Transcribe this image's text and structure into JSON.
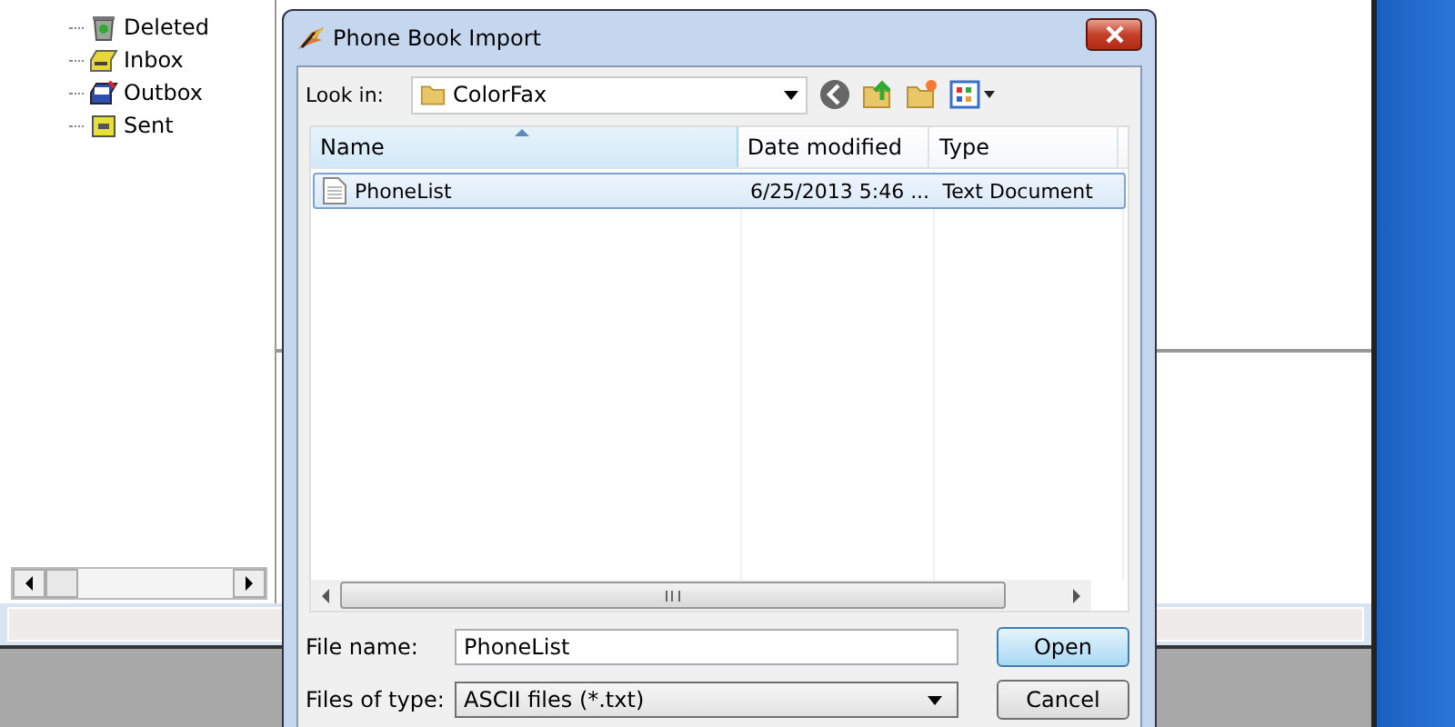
{
  "tree": {
    "items": [
      {
        "label": "Deleted",
        "kind": "trash"
      },
      {
        "label": "Inbox",
        "kind": "inbox"
      },
      {
        "label": "Outbox",
        "kind": "outbox"
      },
      {
        "label": "Sent",
        "kind": "sent"
      }
    ]
  },
  "dialog": {
    "title": "Phone Book Import",
    "look_in_label": "Look in:",
    "look_in_value": "ColorFax",
    "columns": [
      {
        "label": "Name",
        "sorted": true
      },
      {
        "label": "Date modified",
        "sorted": false
      },
      {
        "label": "Type",
        "sorted": false
      }
    ],
    "files": [
      {
        "name": "PhoneList",
        "date": "6/25/2013 5:46 ...",
        "type": "Text Document",
        "selected": true
      }
    ],
    "file_name_label": "File name:",
    "file_name_value": "PhoneList",
    "file_type_label": "Files of type:",
    "file_type_value": "ASCII files (*.txt)",
    "buttons": [
      {
        "label": "Open",
        "default": true
      },
      {
        "label": "Cancel",
        "default": false
      }
    ]
  }
}
